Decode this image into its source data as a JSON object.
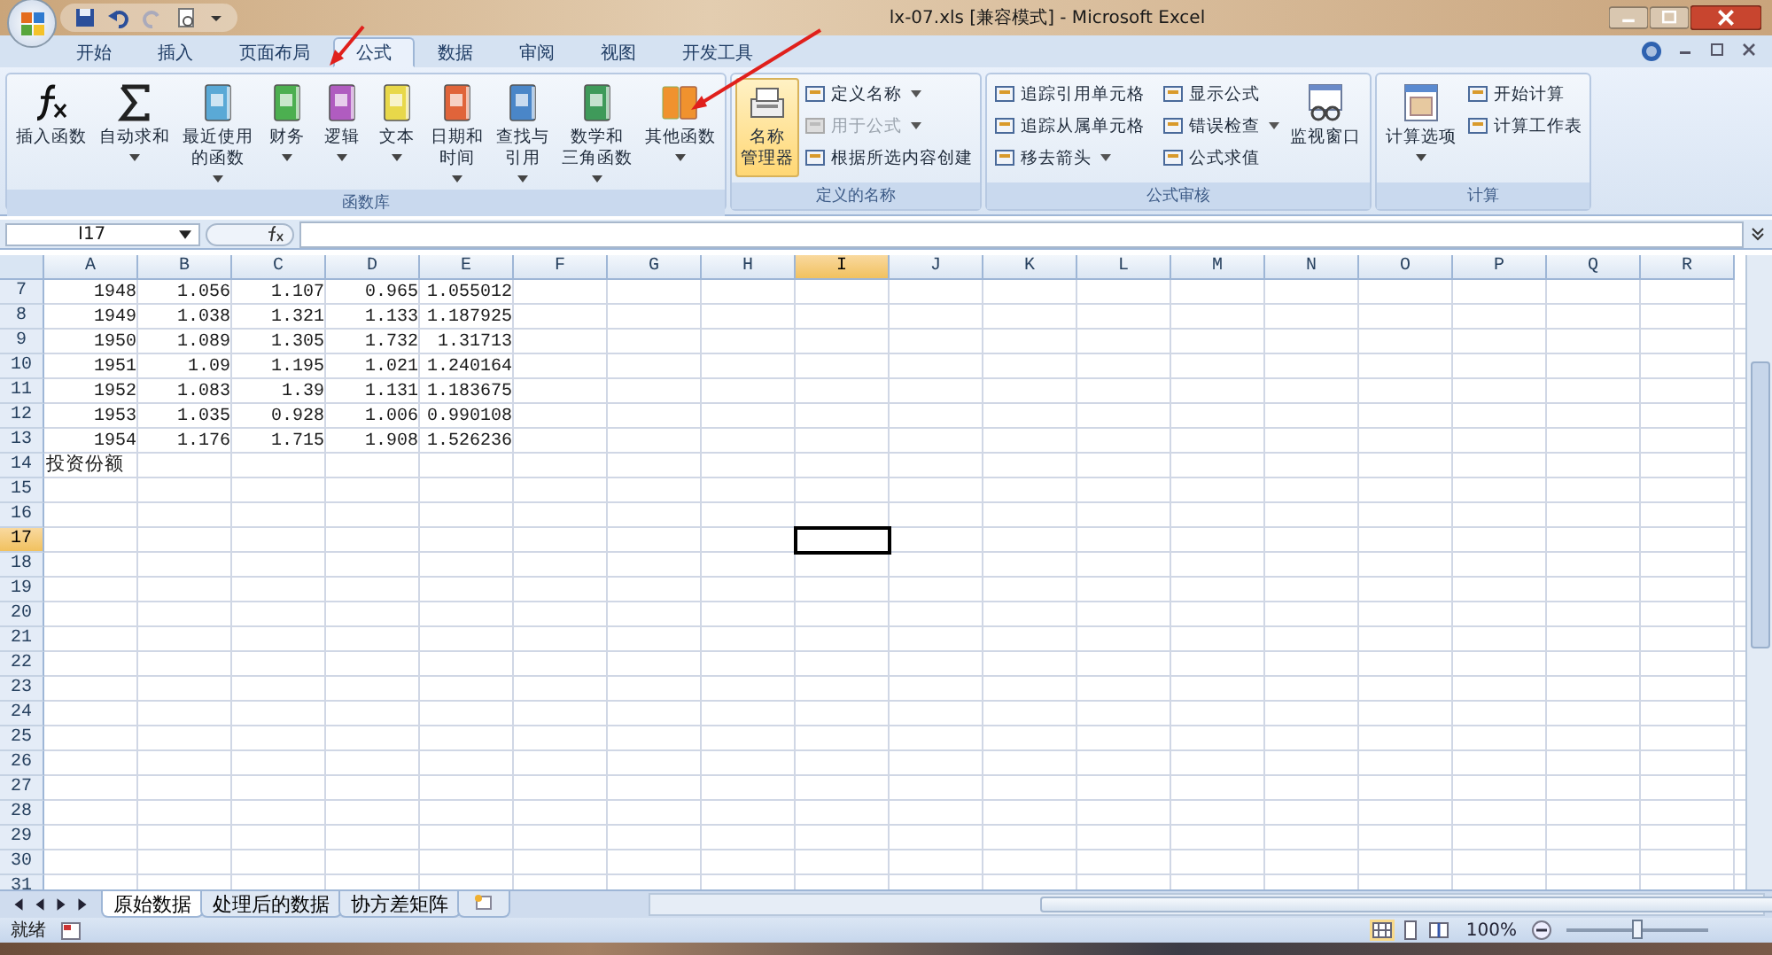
{
  "window": {
    "title": "lx-07.xls  [兼容模式] - Microsoft Excel"
  },
  "tabs": [
    {
      "label": "开始",
      "selected": false
    },
    {
      "label": "插入",
      "selected": false
    },
    {
      "label": "页面布局",
      "selected": false
    },
    {
      "label": "公式",
      "selected": true
    },
    {
      "label": "数据",
      "selected": false
    },
    {
      "label": "审阅",
      "selected": false
    },
    {
      "label": "视图",
      "selected": false
    },
    {
      "label": "开发工具",
      "selected": false
    }
  ],
  "ribbon": {
    "groups": [
      {
        "title": "函数库",
        "large": [
          {
            "kind": "fx",
            "lines": [
              "插入函数"
            ],
            "dropdown": false
          },
          {
            "kind": "sigma",
            "lines": [
              "自动求和"
            ],
            "dropdown": true
          },
          {
            "kind": "book",
            "color": "#5aa9d6",
            "lines": [
              "最近使用",
              "的函数"
            ],
            "dropdown": true
          },
          {
            "kind": "book",
            "color": "#4caf50",
            "lines": [
              "财务"
            ],
            "dropdown": true
          },
          {
            "kind": "book",
            "color": "#b05cc0",
            "lines": [
              "逻辑"
            ],
            "dropdown": true
          },
          {
            "kind": "book",
            "color": "#e8d84a",
            "lines": [
              "文本"
            ],
            "dropdown": true
          },
          {
            "kind": "book",
            "color": "#e0643a",
            "lines": [
              "日期和",
              "时间"
            ],
            "dropdown": true
          },
          {
            "kind": "book",
            "color": "#4a86c8",
            "lines": [
              "查找与",
              "引用"
            ],
            "dropdown": true
          },
          {
            "kind": "book",
            "color": "#3f9a5a",
            "lines": [
              "数学和",
              "三角函数"
            ],
            "dropdown": true
          },
          {
            "kind": "books",
            "color": "#f0922e",
            "lines": [
              "其他函数"
            ],
            "dropdown": true
          }
        ]
      },
      {
        "title": "定义的名称",
        "large": [
          {
            "kind": "tags",
            "lines": [
              "名称",
              "管理器"
            ],
            "dropdown": false,
            "highlighted": true
          }
        ],
        "small": [
          {
            "label": "定义名称",
            "dropdown": true,
            "disabled": false
          },
          {
            "label": "用于公式",
            "dropdown": true,
            "disabled": true
          },
          {
            "label": "根据所选内容创建",
            "dropdown": false,
            "disabled": false
          }
        ]
      },
      {
        "title": "公式审核",
        "small": [
          {
            "label": "追踪引用单元格",
            "dropdown": false,
            "disabled": false
          },
          {
            "label": "追踪从属单元格",
            "dropdown": false,
            "disabled": false
          },
          {
            "label": "移去箭头",
            "dropdown": true,
            "disabled": false
          },
          {
            "label": "显示公式",
            "dropdown": false,
            "disabled": false
          },
          {
            "label": "错误检查",
            "dropdown": true,
            "disabled": false
          },
          {
            "label": "公式求值",
            "dropdown": false,
            "disabled": false
          }
        ],
        "large_after": [
          {
            "kind": "watch",
            "lines": [
              "监视窗口"
            ],
            "dropdown": false
          }
        ]
      },
      {
        "title": "计算",
        "large": [
          {
            "kind": "calc",
            "lines": [
              "计算选项"
            ],
            "dropdown": true
          }
        ],
        "small": [
          {
            "label": "开始计算",
            "dropdown": false,
            "disabled": false
          },
          {
            "label": "计算工作表",
            "dropdown": false,
            "disabled": false
          }
        ]
      }
    ]
  },
  "formula_bar": {
    "name_box": "I17"
  },
  "columns": [
    {
      "label": "A",
      "selected": false
    },
    {
      "label": "B",
      "selected": false
    },
    {
      "label": "C",
      "selected": false
    },
    {
      "label": "D",
      "selected": false
    },
    {
      "label": "E",
      "selected": false
    },
    {
      "label": "F",
      "selected": false
    },
    {
      "label": "G",
      "selected": false
    },
    {
      "label": "H",
      "selected": false
    },
    {
      "label": "I",
      "selected": true
    },
    {
      "label": "J",
      "selected": false
    },
    {
      "label": "K",
      "selected": false
    },
    {
      "label": "L",
      "selected": false
    },
    {
      "label": "M",
      "selected": false
    },
    {
      "label": "N",
      "selected": false
    },
    {
      "label": "O",
      "selected": false
    },
    {
      "label": "P",
      "selected": false
    },
    {
      "label": "Q",
      "selected": false
    },
    {
      "label": "R",
      "selected": false
    }
  ],
  "rows": [
    {
      "number": "7",
      "selected": false,
      "cells": [
        "1948",
        "1.056",
        "1.107",
        "0.965",
        "1.055012"
      ]
    },
    {
      "number": "8",
      "selected": false,
      "cells": [
        "1949",
        "1.038",
        "1.321",
        "1.133",
        "1.187925"
      ]
    },
    {
      "number": "9",
      "selected": false,
      "cells": [
        "1950",
        "1.089",
        "1.305",
        "1.732",
        "1.31713"
      ]
    },
    {
      "number": "10",
      "selected": false,
      "cells": [
        "1951",
        "1.09",
        "1.195",
        "1.021",
        "1.240164"
      ]
    },
    {
      "number": "11",
      "selected": false,
      "cells": [
        "1952",
        "1.083",
        "1.39",
        "1.131",
        "1.183675"
      ]
    },
    {
      "number": "12",
      "selected": false,
      "cells": [
        "1953",
        "1.035",
        "0.928",
        "1.006",
        "0.990108"
      ]
    },
    {
      "number": "13",
      "selected": false,
      "cells": [
        "1954",
        "1.176",
        "1.715",
        "1.908",
        "1.526236"
      ]
    },
    {
      "number": "14",
      "selected": false,
      "cells": [],
      "label": "投资份额"
    },
    {
      "number": "15",
      "selected": false,
      "cells": []
    },
    {
      "number": "16",
      "selected": false,
      "cells": []
    },
    {
      "number": "17",
      "selected": true,
      "cells": []
    },
    {
      "number": "18",
      "selected": false,
      "cells": []
    },
    {
      "number": "19",
      "selected": false,
      "cells": []
    },
    {
      "number": "20",
      "selected": false,
      "cells": []
    },
    {
      "number": "21",
      "selected": false,
      "cells": []
    },
    {
      "number": "22",
      "selected": false,
      "cells": []
    },
    {
      "number": "23",
      "selected": false,
      "cells": []
    },
    {
      "number": "24",
      "selected": false,
      "cells": []
    },
    {
      "number": "25",
      "selected": false,
      "cells": []
    },
    {
      "number": "26",
      "selected": false,
      "cells": []
    },
    {
      "number": "27",
      "selected": false,
      "cells": []
    },
    {
      "number": "28",
      "selected": false,
      "cells": []
    },
    {
      "number": "29",
      "selected": false,
      "cells": []
    },
    {
      "number": "30",
      "selected": false,
      "cells": []
    },
    {
      "number": "31",
      "selected": false,
      "cells": []
    }
  ],
  "sheet_tabs": [
    {
      "label": "原始数据",
      "selected": true
    },
    {
      "label": "处理后的数据",
      "selected": false
    },
    {
      "label": "协方差矩阵",
      "selected": false
    }
  ],
  "status_bar": {
    "text": "就绪",
    "zoom": "100%",
    "zoom_slider": {
      "level": 0.5
    }
  }
}
